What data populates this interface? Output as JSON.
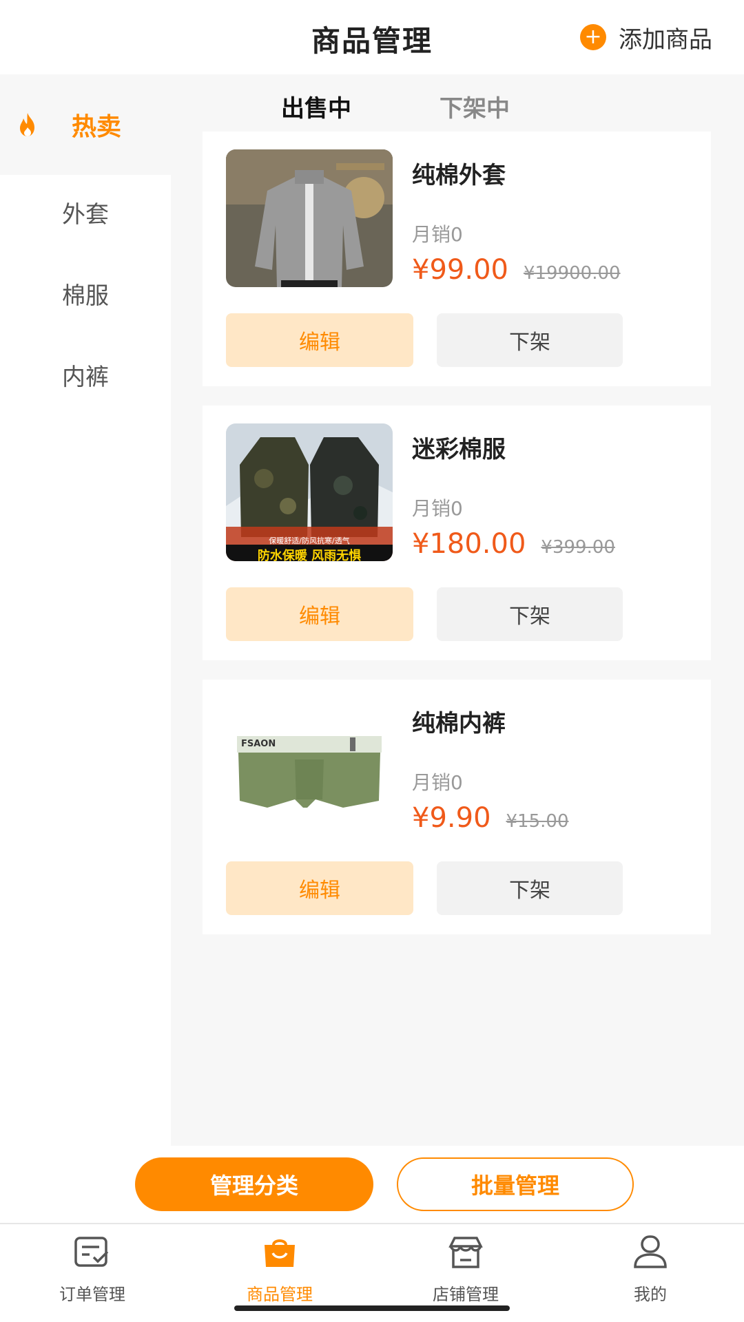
{
  "header": {
    "title": "商品管理",
    "add_icon": "plus-circle-icon",
    "add_label": "添加商品"
  },
  "sidebar": {
    "hot": {
      "icon": "fire-icon",
      "label": "热卖"
    },
    "items": [
      {
        "label": "外套"
      },
      {
        "label": "棉服"
      },
      {
        "label": "内裤"
      }
    ]
  },
  "tabs": [
    {
      "label": "出售中",
      "active": true
    },
    {
      "label": "下架中",
      "active": false
    }
  ],
  "products": [
    {
      "name": "纯棉外套",
      "sales": "月销0",
      "price": "¥99.00",
      "original_price": "¥19900.00",
      "edit_label": "编辑",
      "offshelf_label": "下架"
    },
    {
      "name": "迷彩棉服",
      "sales": "月销0",
      "price": "¥180.00",
      "original_price": "¥399.00",
      "image_caption_small": "保暖舒适/防风抗寒/透气",
      "image_caption_banner": "防水保暖  风雨无惧",
      "edit_label": "编辑",
      "offshelf_label": "下架"
    },
    {
      "name": "纯棉内裤",
      "sales": "月销0",
      "price": "¥9.90",
      "original_price": "¥15.00",
      "image_brand": "FSAON",
      "edit_label": "编辑",
      "offshelf_label": "下架"
    }
  ],
  "actions": {
    "manage_category": "管理分类",
    "batch_manage": "批量管理"
  },
  "nav": [
    {
      "icon": "order-list-icon",
      "label": "订单管理",
      "active": false
    },
    {
      "icon": "shopping-bag-icon",
      "label": "商品管理",
      "active": true
    },
    {
      "icon": "store-icon",
      "label": "店铺管理",
      "active": false
    },
    {
      "icon": "user-icon",
      "label": "我的",
      "active": false
    }
  ],
  "colors": {
    "accent": "#ff8a00",
    "price": "#f05a1a",
    "edit_bg": "#ffe7c6"
  }
}
